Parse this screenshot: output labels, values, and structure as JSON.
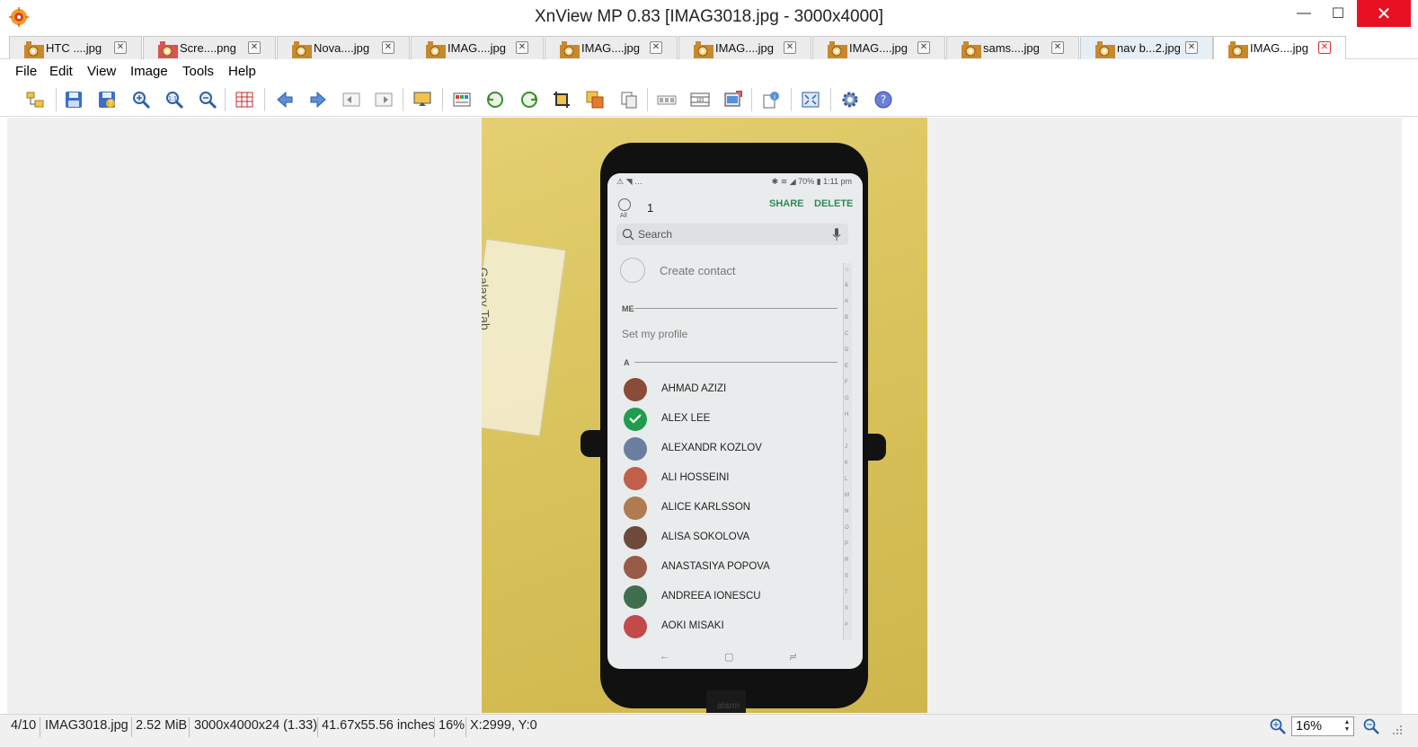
{
  "window": {
    "title": "XnView MP 0.83 [IMAG3018.jpg - 3000x4000]",
    "minimize": "—",
    "maximize": "☐",
    "close": "✕"
  },
  "tabs": [
    {
      "label": "HTC ....jpg",
      "close": "✕",
      "active": false
    },
    {
      "label": "Scre....png",
      "close": "✕",
      "active": false
    },
    {
      "label": "Nova....jpg",
      "close": "✕",
      "active": false
    },
    {
      "label": "IMAG....jpg",
      "close": "✕",
      "active": false
    },
    {
      "label": "IMAG....jpg",
      "close": "✕",
      "active": false
    },
    {
      "label": "IMAG....jpg",
      "close": "✕",
      "active": false
    },
    {
      "label": "IMAG....jpg",
      "close": "✕",
      "active": false
    },
    {
      "label": "sams....jpg",
      "close": "✕",
      "active": false
    },
    {
      "label": "nav b...2.jpg",
      "close": "✕",
      "active": false
    },
    {
      "label": "IMAG....jpg",
      "close": "✕",
      "active": true
    }
  ],
  "menu": [
    "File",
    "Edit",
    "View",
    "Image",
    "Tools",
    "Help"
  ],
  "toolbar_icons": [
    "browser-icon",
    "save-icon",
    "save-as-icon",
    "zoom-in-icon",
    "zoom-fit-icon",
    "zoom-out-icon",
    "grid-icon",
    "previous-icon",
    "next-icon",
    "first-icon",
    "last-icon",
    "slideshow-icon",
    "adjust-icon",
    "rotate-left-icon",
    "rotate-right-icon",
    "crop-icon",
    "resize-icon",
    "copy-icon",
    "compare-icon",
    "filmstrip-icon",
    "export-icon",
    "properties-icon",
    "fullscreen-icon",
    "settings-icon",
    "help-icon"
  ],
  "photo": {
    "box_text": "Galaxy Tab",
    "status_left": "⚠ ◥ …",
    "status_right": "✱ ≋ ◢ 70% ▮ 1:11 pm",
    "select_all": "All",
    "selected_count": "1",
    "share": "SHARE",
    "delete": "DELETE",
    "search_placeholder": "Search",
    "create_contact": "Create contact",
    "section_me": "ME",
    "set_profile": "Set my profile",
    "section_a": "A",
    "contacts": [
      {
        "name": "AHMAD AZIZI",
        "color": "#8a4b3a"
      },
      {
        "name": "ALEX LEE",
        "color": "#1f9d4f",
        "checked": true
      },
      {
        "name": "ALEXANDR KOZLOV",
        "color": "#6a7fa0"
      },
      {
        "name": "ALI HOSSEINI",
        "color": "#c0604a"
      },
      {
        "name": "ALICE KARLSSON",
        "color": "#b07a52"
      },
      {
        "name": "ALISA SOKOLOVA",
        "color": "#6e4a3c"
      },
      {
        "name": "ANASTASIYA POPOVA",
        "color": "#9a5a4a"
      },
      {
        "name": "ANDREEA IONESCU",
        "color": "#3f6e4f"
      },
      {
        "name": "AOKI MISAKI",
        "color": "#c24a4a"
      }
    ],
    "az_letters": [
      "☆",
      "&",
      "A",
      "B",
      "C",
      "D",
      "E",
      "F",
      "G",
      "H",
      "I",
      "J",
      "K",
      "L",
      "M",
      "N",
      "O",
      "P",
      "R",
      "S",
      "T",
      "X",
      "#"
    ],
    "nav_back": "←",
    "nav_home": "▢",
    "nav_recent": "≓",
    "brand": "alarm"
  },
  "statusbar": {
    "index": "4/10",
    "filename": "IMAG3018.jpg",
    "filesize": "2.52 MiB",
    "dimensions": "3000x4000x24 (1.33)",
    "print_size": "41.67x55.56 inches",
    "zoom": "16%",
    "coords": "X:2999, Y:0",
    "zoom_field": "16%"
  }
}
